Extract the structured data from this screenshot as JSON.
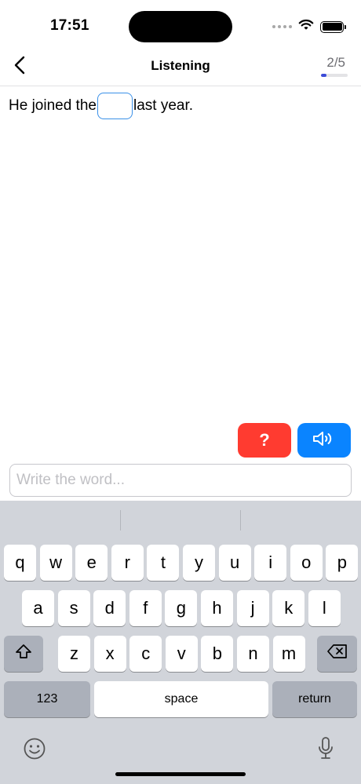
{
  "status": {
    "time": "17:51"
  },
  "nav": {
    "title": "Listening",
    "progress_label": "2/5",
    "progress_fraction": 0.2
  },
  "exercise": {
    "before_blank": "He joined the",
    "after_blank": "last year."
  },
  "actions": {
    "hint_label": "?",
    "hint_color": "#ff3b30",
    "audio_icon": "speaker-icon",
    "audio_color": "#0a84ff"
  },
  "input": {
    "placeholder": "Write the word...",
    "value": ""
  },
  "keyboard": {
    "row1": [
      "q",
      "w",
      "e",
      "r",
      "t",
      "y",
      "u",
      "i",
      "o",
      "p"
    ],
    "row2": [
      "a",
      "s",
      "d",
      "f",
      "g",
      "h",
      "j",
      "k",
      "l"
    ],
    "row3": [
      "z",
      "x",
      "c",
      "v",
      "b",
      "n",
      "m"
    ],
    "numbers_label": "123",
    "space_label": "space",
    "return_label": "return"
  },
  "icons": {
    "back": "chevron-left-icon",
    "shift": "shift-icon",
    "delete": "backspace-icon",
    "emoji": "emoji-icon",
    "dictation": "microphone-icon"
  }
}
